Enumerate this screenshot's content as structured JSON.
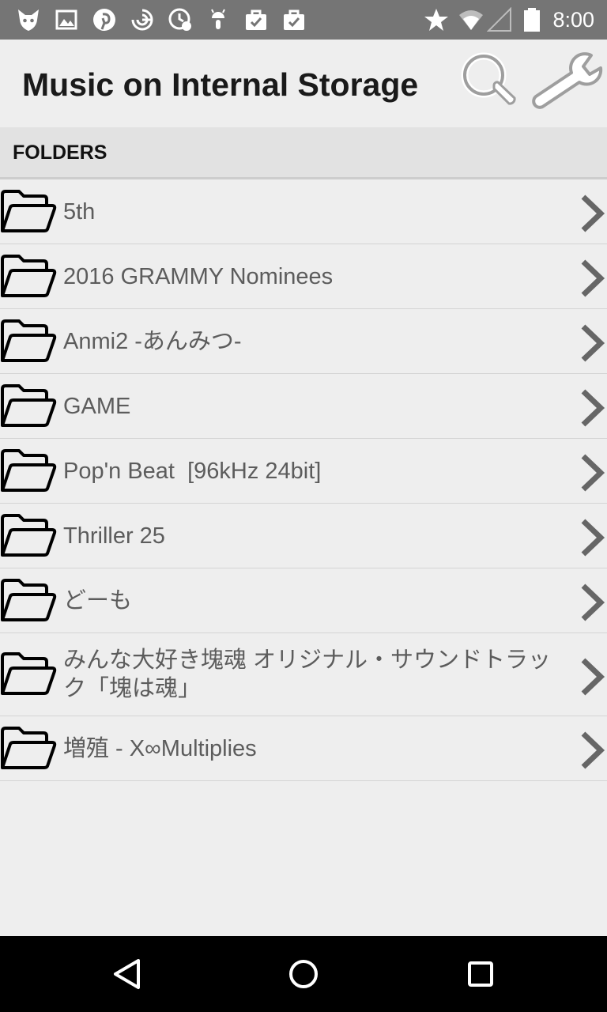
{
  "status_bar": {
    "time": "8:00",
    "left_icons": [
      "fox-icon",
      "image-icon",
      "pinterest-icon",
      "swirl-icon",
      "clock-info-icon",
      "android-icon",
      "shopping-bag-icon",
      "shopping-bag-icon"
    ],
    "right_icons": [
      "star-icon",
      "wifi-icon",
      "signal-icon",
      "battery-icon"
    ]
  },
  "app_bar": {
    "title": "Music on Internal Storage",
    "actions": [
      "search-icon",
      "wrench-icon"
    ]
  },
  "section": {
    "title": "FOLDERS"
  },
  "folders": [
    {
      "label": "5th"
    },
    {
      "label": "2016 GRAMMY Nominees"
    },
    {
      "label": "Anmi2 -あんみつ-"
    },
    {
      "label": "GAME"
    },
    {
      "label": "Pop'n Beat  [96kHz 24bit]"
    },
    {
      "label": "Thriller 25"
    },
    {
      "label": "どーも"
    },
    {
      "label": "みんな大好き塊魂 オリジナル・サウンドトラック「塊は魂」"
    },
    {
      "label": "増殖 - X∞Multiplies"
    }
  ],
  "nav_bar": {
    "buttons": [
      "back-icon",
      "home-icon",
      "recents-icon"
    ]
  },
  "colors": {
    "status_bar": "#757575",
    "background": "#eeeeee",
    "section_header": "#e2e2e2",
    "nav_bar": "#000000",
    "row_text": "#5c5c5c"
  }
}
